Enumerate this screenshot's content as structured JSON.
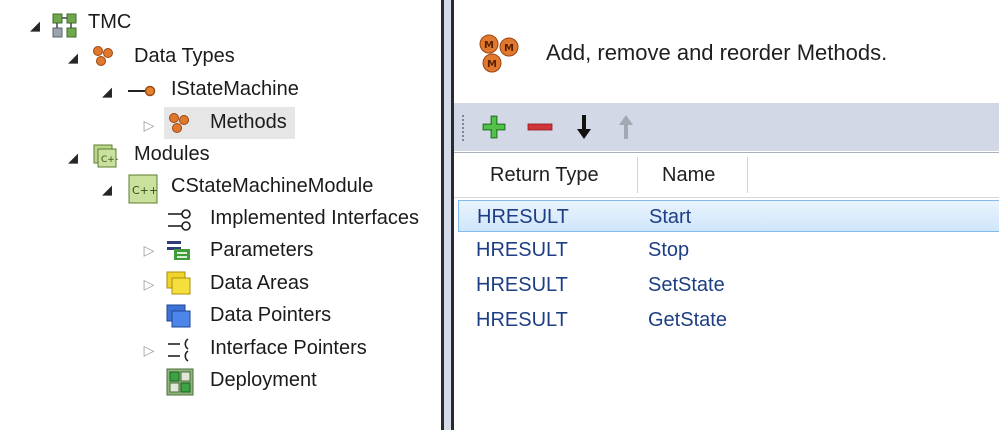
{
  "tree": {
    "root": "TMC",
    "data_types": "Data Types",
    "interface": "IStateMachine",
    "methods": "Methods",
    "modules": "Modules",
    "module": "CStateMachineModule",
    "children": [
      {
        "label": "Implemented Interfaces",
        "icon": "implemented-interface-icon"
      },
      {
        "label": "Parameters",
        "icon": "parameters-icon"
      },
      {
        "label": "Data Areas",
        "icon": "data-areas-icon"
      },
      {
        "label": "Data Pointers",
        "icon": "data-pointers-icon"
      },
      {
        "label": "Interface Pointers",
        "icon": "interface-pointers-icon"
      },
      {
        "label": "Deployment",
        "icon": "deployment-icon"
      }
    ]
  },
  "header": {
    "text": "Add, remove and reorder Methods."
  },
  "toolbar": {
    "add": "add-icon",
    "remove": "remove-icon",
    "move_down": "arrow-down-icon",
    "move_up": "arrow-up-icon"
  },
  "grid": {
    "columns": [
      "Return Type",
      "Name"
    ],
    "rows": [
      {
        "return_type": "HRESULT",
        "name": "Start"
      },
      {
        "return_type": "HRESULT",
        "name": "Stop"
      },
      {
        "return_type": "HRESULT",
        "name": "SetState"
      },
      {
        "return_type": "HRESULT",
        "name": "GetState"
      }
    ],
    "selected_row": 0
  },
  "colors": {
    "accent_green": "#3aa435",
    "accent_red": "#d2343b",
    "selection_border": "#84b9eb",
    "cell_text": "#1d3e84",
    "toolbar_bg": "#d2d8e6"
  }
}
